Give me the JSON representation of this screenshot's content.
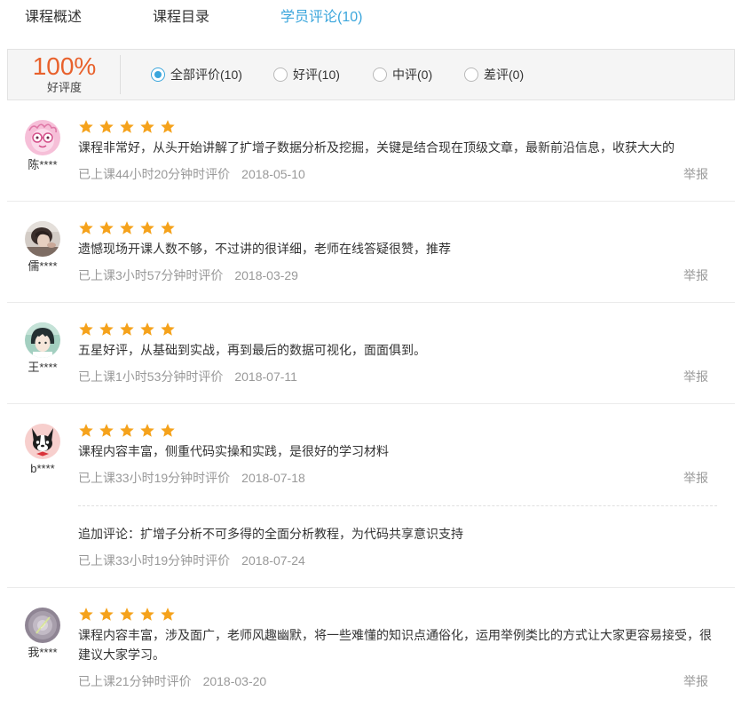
{
  "tabs": [
    {
      "label": "课程概述",
      "active": false
    },
    {
      "label": "课程目录",
      "active": false
    },
    {
      "label": "学员评论(10)",
      "active": true
    }
  ],
  "summary": {
    "rate": "100%",
    "label": "好评度"
  },
  "filters": [
    {
      "label": "全部评价(10)",
      "selected": true
    },
    {
      "label": "好评(10)",
      "selected": false
    },
    {
      "label": "中评(0)",
      "selected": false
    },
    {
      "label": "差评(0)",
      "selected": false
    }
  ],
  "reviews": [
    {
      "user": "陈****",
      "avatar": "pink-cartoon-avatar",
      "rating": 5,
      "text": "课程非常好，从头开始讲解了扩增子数据分析及挖掘，关键是结合现在顶级文章，最新前沿信息，收获大大的",
      "meta": "已上课44小时20分钟时评价",
      "date": "2018-05-10",
      "report": "举报"
    },
    {
      "user": "儒****",
      "avatar": "photo-avatar",
      "rating": 5,
      "text": "遗憾现场开课人数不够，不过讲的很详细，老师在线答疑很赞，推荐",
      "meta": "已上课3小时57分钟时评价",
      "date": "2018-03-29",
      "report": "举报"
    },
    {
      "user": "王****",
      "avatar": "anime-boy-avatar",
      "rating": 5,
      "text": "五星好评，从基础到实战，再到最后的数据可视化，面面俱到。",
      "meta": "已上课1小时53分钟时评价",
      "date": "2018-07-11",
      "report": "举报"
    },
    {
      "user": "b****",
      "avatar": "dog-avatar",
      "rating": 5,
      "text": "课程内容丰富，侧重代码实操和实践，是很好的学习材料",
      "meta": "已上课33小时19分钟时评价",
      "date": "2018-07-18",
      "report": "举报",
      "append": {
        "text": "追加评论：扩增子分析不可多得的全面分析教程，为代码共享意识支持",
        "meta": "已上课33小时19分钟时评价",
        "date": "2018-07-24"
      }
    },
    {
      "user": "我****",
      "avatar": "purple-avatar",
      "rating": 5,
      "text": "课程内容丰富，涉及面广，老师风趣幽默，将一些难懂的知识点通俗化，运用举例类比的方式让大家更容易接受，很建议大家学习。",
      "meta": "已上课21分钟时评价",
      "date": "2018-03-20",
      "report": "举报"
    }
  ],
  "icons": {
    "star": "star-icon",
    "radio": "radio-icon"
  },
  "colors": {
    "accent": "#3ba6dc",
    "rate": "#e8612c",
    "star": "#f5a21b",
    "meta": "#999999"
  }
}
